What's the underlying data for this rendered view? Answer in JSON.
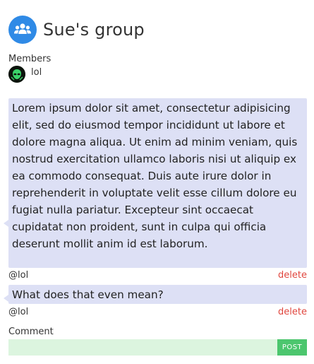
{
  "group": {
    "icon": "group-icon",
    "title": "Sue's group"
  },
  "members": {
    "label": "Members",
    "items": [
      {
        "name": "lol",
        "icon": "alien-avatar-icon"
      }
    ]
  },
  "messages": [
    {
      "text": "Lorem ipsum dolor sit amet, consectetur adipisicing elit, sed do eiusmod tempor incididunt ut labore et dolore magna aliqua. Ut enim ad minim veniam, quis nostrud exercitation ullamco laboris nisi ut aliquip ex ea commodo consequat. Duis aute irure dolor in reprehenderit in voluptate velit esse cillum dolore eu fugiat nulla pariatur. Excepteur sint occaecat cupidatat non proident, sunt in culpa qui officia deserunt mollit anim id est laborum.",
      "author": "@lol",
      "delete_label": "delete"
    },
    {
      "text": "What does that even mean?",
      "author": "@lol",
      "delete_label": "delete"
    }
  ],
  "comment": {
    "label": "Comment",
    "value": "",
    "post_label": "POST"
  },
  "colors": {
    "group_icon_bg": "#2f8ae6",
    "bubble_bg": "#dde0f5",
    "delete": "#e0463e",
    "comment_bg": "#dcf5df",
    "post_bg": "#4cc66e"
  }
}
